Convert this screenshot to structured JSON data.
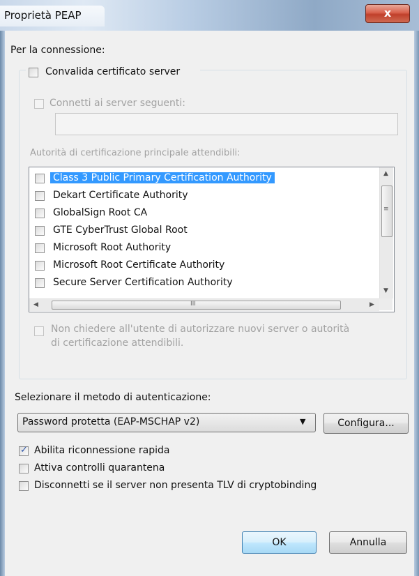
{
  "window": {
    "title": "Proprietà PEAP",
    "close_label": "x"
  },
  "connection": {
    "heading": "Per la connessione:",
    "validate_cert": {
      "label": "Convalida certificato server",
      "checked": false
    },
    "connect_to_servers": {
      "label": "Connetti ai server seguenti:",
      "checked": false,
      "value": ""
    },
    "trusted_ca_label": "Autorità di certificazione principale attendibili:",
    "ca_list": [
      {
        "label": "Class 3 Public Primary Certification Authority",
        "checked": false,
        "selected": true
      },
      {
        "label": "Dekart Certificate Authority",
        "checked": false,
        "selected": false
      },
      {
        "label": "GlobalSign Root CA",
        "checked": false,
        "selected": false
      },
      {
        "label": "GTE CyberTrust Global Root",
        "checked": false,
        "selected": false
      },
      {
        "label": "Microsoft Root Authority",
        "checked": false,
        "selected": false
      },
      {
        "label": "Microsoft Root Certificate Authority",
        "checked": false,
        "selected": false
      },
      {
        "label": "Secure Server Certification Authority",
        "checked": false,
        "selected": false
      }
    ],
    "dont_prompt": {
      "line1": "Non chiedere all'utente di autorizzare nuovi server o autorità",
      "line2": "di certificazione attendibili.",
      "checked": false
    }
  },
  "auth": {
    "label": "Selezionare il metodo di autenticazione:",
    "method_selected": "Password protetta (EAP-MSCHAP v2)",
    "configure_label": "Configura..."
  },
  "options": {
    "fast_reconnect": {
      "label": "Abilita riconnessione rapida",
      "checked": true
    },
    "quarantine": {
      "label": "Attiva controlli quarantena",
      "checked": false
    },
    "cryptobinding": {
      "label": "Disconnetti se il server non presenta TLV di cryptobinding",
      "checked": false
    }
  },
  "buttons": {
    "ok": "OK",
    "cancel": "Annulla"
  },
  "scrollbar": {
    "h_thumb_grip": "III",
    "v_thumb_grip": "≡"
  },
  "colors": {
    "selection": "#3399ff",
    "disabled_text": "#a2a2a2"
  }
}
